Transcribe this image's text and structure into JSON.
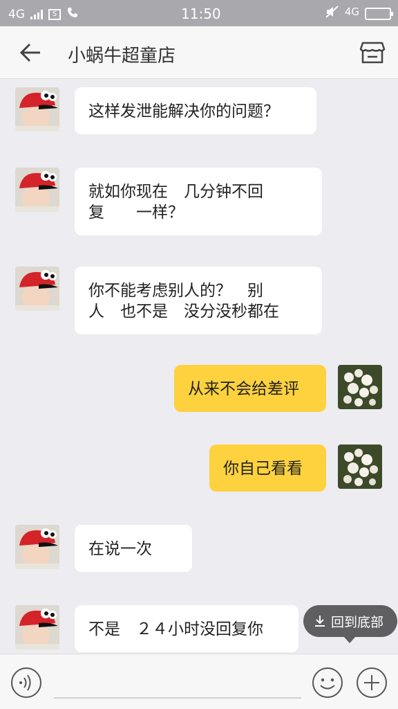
{
  "status_bar": {
    "network_left": "4G",
    "time": "11:50",
    "network_right": "4G",
    "sim_icon_label": "S"
  },
  "header": {
    "title": "小蜗牛超童店",
    "back_icon": "back-arrow-icon",
    "shop_icon": "store-icon"
  },
  "messages": [
    {
      "side": "in",
      "text": "这样发泄能解决你的问题？"
    },
    {
      "side": "in",
      "text": "就如你现在　几分钟不回\n复　　一样？"
    },
    {
      "side": "in",
      "text": "你不能考虑别人的？　别\n人　也不是　没分没秒都在"
    },
    {
      "side": "out",
      "text": "从来不会给差评"
    },
    {
      "side": "out",
      "text": "你自己看看"
    },
    {
      "side": "in",
      "text": "在说一次"
    },
    {
      "side": "in",
      "text": "不是　２４小时没回复你"
    }
  ],
  "jump_to_bottom": {
    "label": "回到底部",
    "icon": "download-arrow-icon"
  },
  "input_bar": {
    "voice_icon": "voice-icon",
    "emoji_icon": "smiley-icon",
    "plus_icon": "plus-icon",
    "text_value": ""
  },
  "colors": {
    "outgoing_bubble": "#fdd23e",
    "incoming_bubble": "#ffffff",
    "background": "#ececf1"
  }
}
